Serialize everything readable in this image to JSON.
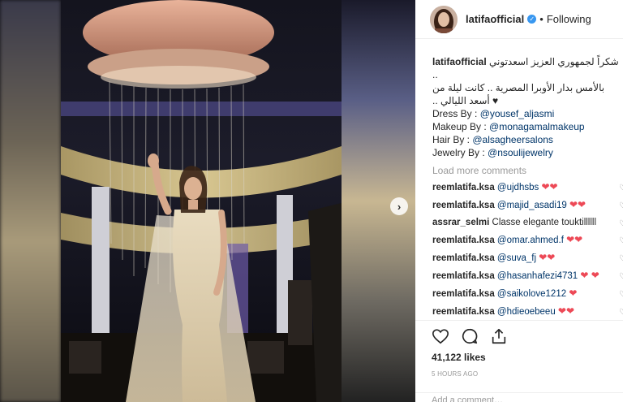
{
  "post": {
    "username": "latifaofficial",
    "follow_status": "Following",
    "caption_line1": "شكراً لجمهوري العزيز اسعدتوني .. ",
    "caption_line2": "بالأمس بدار الأوبرا المصرية .. كانت ليلة من",
    "caption_line3": "♥ أسعد الليالي ..",
    "credits": [
      {
        "label": "Dress By : ",
        "handle": "@yousef_aljasmi"
      },
      {
        "label": "Makeup By : ",
        "handle": "@monagamalmakeup"
      },
      {
        "label": "Hair By : ",
        "handle": "@alsagheersalons"
      },
      {
        "label": "Jewelry By : ",
        "handle": "@nsoulijewelry"
      }
    ],
    "load_more": "Load more comments",
    "comments": [
      {
        "user": "reemlatifa.ksa",
        "mention": "@ujdhsbs",
        "text": "",
        "hearts": "❤❤"
      },
      {
        "user": "reemlatifa.ksa",
        "mention": "@majid_asadi19",
        "text": "",
        "hearts": "❤❤"
      },
      {
        "user": "assrar_selmi",
        "mention": "",
        "text": "Classe elegante touktillllll",
        "hearts": ""
      },
      {
        "user": "reemlatifa.ksa",
        "mention": "@omar.ahmed.f",
        "text": "",
        "hearts": "❤❤"
      },
      {
        "user": "reemlatifa.ksa",
        "mention": "@suva_fj",
        "text": "",
        "hearts": "❤❤"
      },
      {
        "user": "reemlatifa.ksa",
        "mention": "@hasanhafezi4731",
        "text": "",
        "hearts": "❤ ❤"
      },
      {
        "user": "reemlatifa.ksa",
        "mention": "@saikolove1212",
        "text": "",
        "hearts": "❤"
      },
      {
        "user": "reemlatifa.ksa",
        "mention": "@hdieoebeeu",
        "text": "",
        "hearts": "❤❤"
      }
    ],
    "likes": "41,122 likes",
    "time": "5 HOURS AGO",
    "add_comment_placeholder": "Add a comment…",
    "icons": {
      "like": "heart-icon",
      "comment": "comment-icon",
      "share": "share-icon",
      "next": "chevron-right-icon",
      "verified": "verified-badge-icon"
    }
  }
}
